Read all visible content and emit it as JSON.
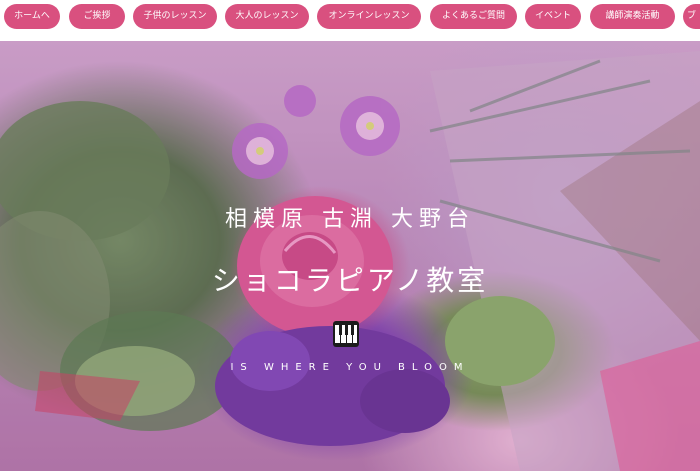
{
  "nav": {
    "items": [
      {
        "label": "ホームへ"
      },
      {
        "label": "ご挨拶"
      },
      {
        "label": "子供のレッスン"
      },
      {
        "label": "大人のレッスン"
      },
      {
        "label": "オンラインレッスン"
      },
      {
        "label": "よくあるご質問"
      },
      {
        "label": "イベント"
      },
      {
        "label": "講師演奏活動"
      },
      {
        "label": "ブ"
      }
    ],
    "button_color": "#d9507f"
  },
  "hero": {
    "location": "相模原 古淵 大野台",
    "title": "ショコラピアノ教室",
    "icon": "piano-keyboard-icon",
    "tagline": "IS WHERE YOU BLOOM"
  }
}
